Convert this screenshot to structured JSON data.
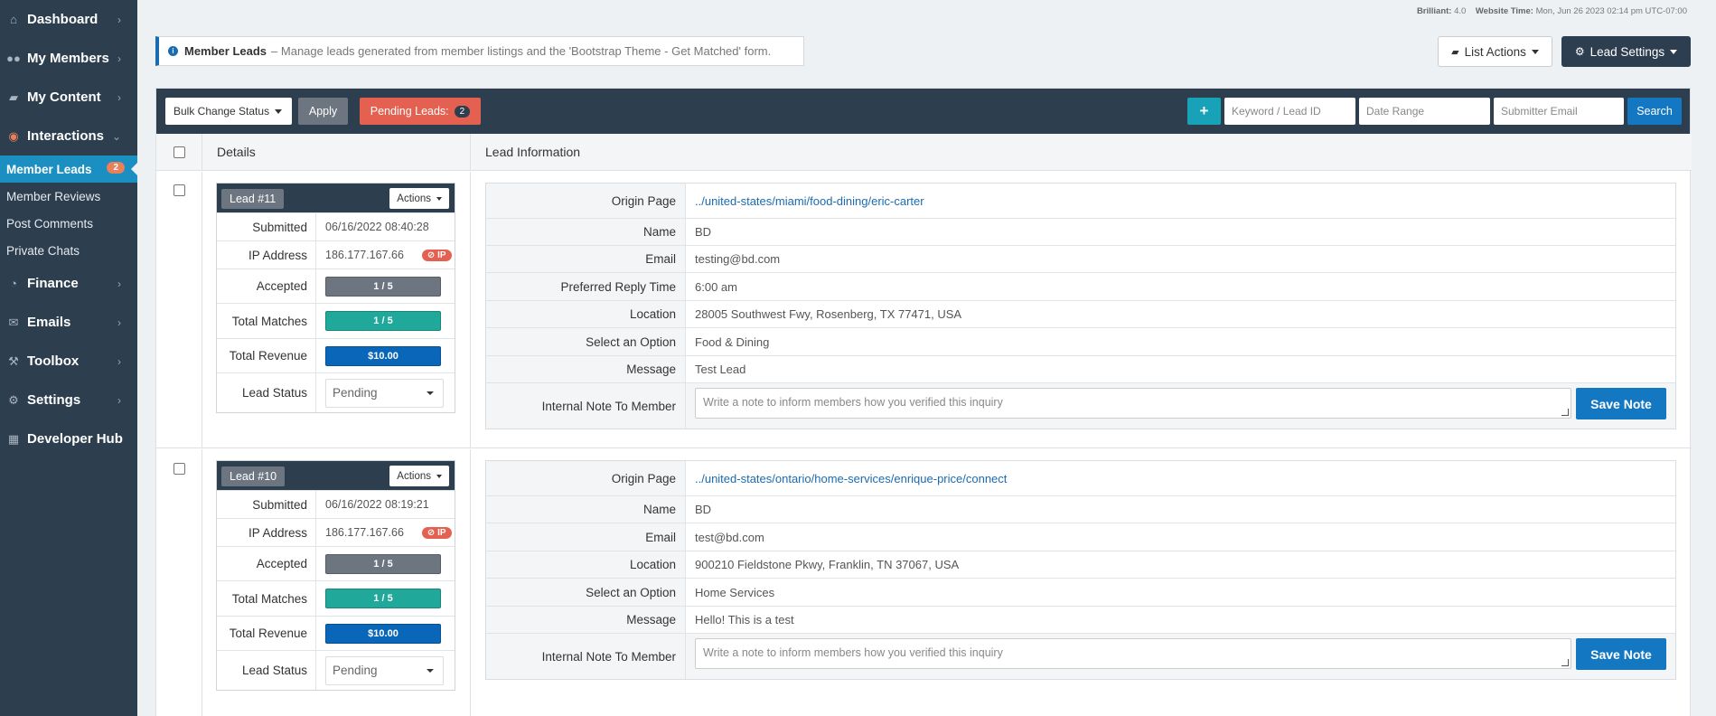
{
  "sidebar": {
    "items": [
      {
        "label": "Dashboard",
        "icon": "home-icon"
      },
      {
        "label": "My Members",
        "icon": "users-icon"
      },
      {
        "label": "My Content",
        "icon": "folder-icon"
      },
      {
        "label": "Interactions",
        "icon": "comments-icon"
      }
    ],
    "sub_items": [
      {
        "label": "Member Leads",
        "badge": "2",
        "active": true
      },
      {
        "label": "Member Reviews"
      },
      {
        "label": "Post Comments"
      },
      {
        "label": "Private Chats"
      }
    ],
    "items_after": [
      {
        "label": "Finance",
        "icon": "pie-chart-icon"
      },
      {
        "label": "Emails",
        "icon": "envelope-icon"
      },
      {
        "label": "Toolbox",
        "icon": "wrench-icon"
      },
      {
        "label": "Settings",
        "icon": "gear-icon"
      },
      {
        "label": "Developer Hub",
        "icon": "grid-icon"
      }
    ]
  },
  "topinfo": {
    "version_label": "Brilliant:",
    "version": "4.0",
    "time_label": "Website Time:",
    "time": "Mon, Jun 26 2023 02:14 pm UTC-07:00"
  },
  "notice": {
    "title": "Member Leads",
    "text": "– Manage leads generated from member listings and the 'Bootstrap Theme - Get Matched' form."
  },
  "header_buttons": {
    "list_actions": "List Actions",
    "lead_settings": "Lead Settings"
  },
  "toolbar": {
    "bulk_select": "Bulk Change Status",
    "apply": "Apply",
    "pending_label": "Pending Leads:",
    "pending_count": "2",
    "plus": "+",
    "keyword_placeholder": "Keyword / Lead ID",
    "date_placeholder": "Date Range",
    "email_placeholder": "Submitter Email",
    "search": "Search"
  },
  "table_headers": {
    "details": "Details",
    "lead_info": "Lead Information"
  },
  "card_labels": {
    "actions": "Actions",
    "submitted": "Submitted",
    "ip": "IP Address",
    "ip_badge": "IP",
    "accepted": "Accepted",
    "total_matches": "Total Matches",
    "total_revenue": "Total Revenue",
    "lead_status": "Lead Status",
    "internal_note": "Internal Note To Member",
    "note_placeholder": "Write a note to inform members how you verified this inquiry",
    "save_note": "Save Note"
  },
  "colors": {
    "accepted": "#6d7680",
    "matches": "#20a89a",
    "revenue": "#0a66b8"
  },
  "leads": [
    {
      "tag": "Lead #11",
      "submitted": "06/16/2022 08:40:28",
      "ip": "186.177.167.66",
      "accepted": "1 / 5",
      "total_matches": "1 / 5",
      "total_revenue": "$10.00",
      "status": "Pending",
      "info": [
        {
          "key": "Origin Page",
          "value": "../united-states/miami/food-dining/eric-carter",
          "link": true
        },
        {
          "key": "Name",
          "value": "BD"
        },
        {
          "key": "Email",
          "value": "testing@bd.com"
        },
        {
          "key": "Preferred Reply Time",
          "value": "6:00 am"
        },
        {
          "key": "Location",
          "value": "28005 Southwest Fwy, Rosenberg, TX 77471, USA"
        },
        {
          "key": "Select an Option",
          "value": "Food & Dining"
        },
        {
          "key": "Message",
          "value": "Test Lead"
        }
      ]
    },
    {
      "tag": "Lead #10",
      "submitted": "06/16/2022 08:19:21",
      "ip": "186.177.167.66",
      "accepted": "1 / 5",
      "total_matches": "1 / 5",
      "total_revenue": "$10.00",
      "status": "Pending",
      "info": [
        {
          "key": "Origin Page",
          "value": "../united-states/ontario/home-services/enrique-price/connect",
          "link": true
        },
        {
          "key": "Name",
          "value": "BD"
        },
        {
          "key": "Email",
          "value": "test@bd.com"
        },
        {
          "key": "Location",
          "value": "900210 Fieldstone Pkwy, Franklin, TN 37067, USA"
        },
        {
          "key": "Select an Option",
          "value": "Home Services"
        },
        {
          "key": "Message",
          "value": "Hello! This is a test"
        }
      ]
    }
  ]
}
